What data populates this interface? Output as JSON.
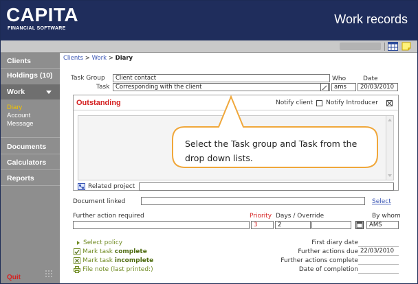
{
  "app": {
    "brand_main": "CAPITA",
    "brand_sub": "FINANCIAL SOFTWARE",
    "title": "Work records"
  },
  "colors": {
    "header_bg": "#1f2d5c",
    "sidebar_bg": "#8e8e8e",
    "accent_active": "#f0c200",
    "alert_red": "#d42020",
    "link_blue": "#3a55b4",
    "action_green": "#6f8a21",
    "callout_border": "#f0a73a"
  },
  "sidebar": {
    "items": [
      {
        "label": "Clients"
      },
      {
        "label": "Holdings (10)"
      },
      {
        "label": "Work"
      },
      {
        "label": "Documents"
      },
      {
        "label": "Calculators"
      },
      {
        "label": "Reports"
      }
    ],
    "work_subitems": [
      {
        "label": "Diary",
        "active": true
      },
      {
        "label": "Account",
        "active": false
      },
      {
        "label": "Message",
        "active": false
      }
    ],
    "quit_label": "Quit"
  },
  "breadcrumb": {
    "clients": "Clients",
    "sep": ">",
    "work": "Work",
    "current": "Diary"
  },
  "form": {
    "task_group_label": "Task Group",
    "task_group_value": "Client contact",
    "task_label": "Task",
    "task_value": "Corresponding with the client",
    "who_label": "Who",
    "who_value": "ams",
    "date_label": "Date",
    "date_value": "20/03/2010",
    "outstanding_title": "Outstanding",
    "notify_client_label": "Notify client",
    "notify_client_checked": false,
    "notify_introducer_label": "Notify Introducer",
    "notify_introducer_checked": true,
    "related_project_label": "Related project",
    "related_project_value": "",
    "document_linked_label": "Document linked",
    "document_linked_value": "",
    "select_link": "Select",
    "further_action_label": "Further action required",
    "further_action_value": "",
    "priority_label": "Priority",
    "priority_value": "3",
    "days_override_label": "Days / Override",
    "days_value": "2",
    "override_value": "",
    "by_whom_label": "By whom",
    "by_whom_value": "AMS"
  },
  "actions": {
    "select_policy": "Select policy",
    "mark_complete_prefix": "Mark task ",
    "mark_complete_bold": "complete",
    "mark_incomplete_prefix": "Mark task ",
    "mark_incomplete_bold": "incomplete",
    "file_note": "File note (last printed:)"
  },
  "dates": {
    "first_diary_label": "First diary date",
    "first_diary_value": "",
    "further_due_label": "Further actions due",
    "further_due_value": "22/03/2010",
    "further_complete_label": "Further actions complete",
    "further_complete_value": "",
    "completion_label": "Date of completion",
    "completion_value": ""
  },
  "callout": {
    "text": "Select the Task group and Task from the drop down lists."
  },
  "icons": {
    "toolbar": [
      "grid-view-icon",
      "note-icon"
    ],
    "calendar": "calendar-icon",
    "related": "related-project-icon",
    "actions": [
      "arrow-bullet-icon",
      "check-box-icon",
      "cross-box-icon",
      "printer-icon"
    ]
  }
}
